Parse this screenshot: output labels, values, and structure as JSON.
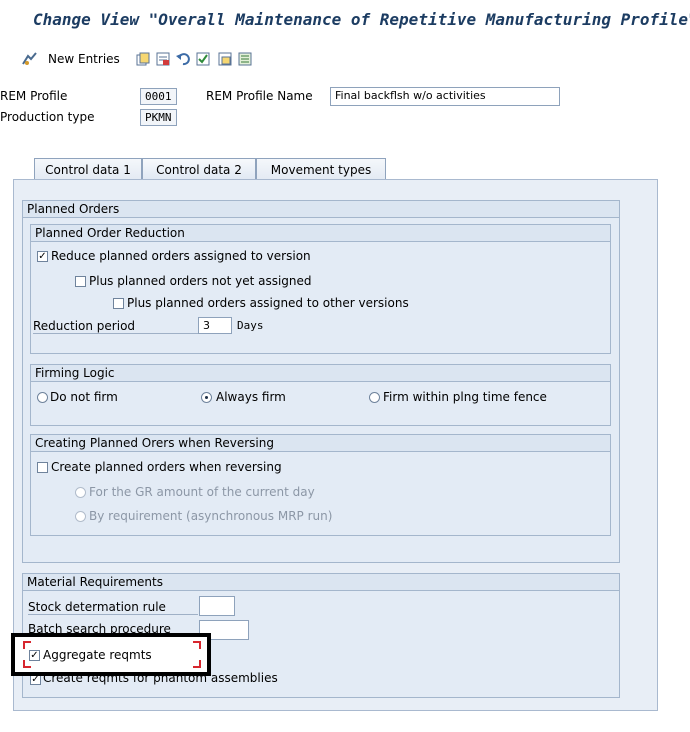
{
  "title": "Change View \"Overall Maintenance of Repetitive Manufacturing Profile\":",
  "toolbar": {
    "new_entries": "New Entries",
    "icons": [
      "change-display-icon",
      "copy-icon",
      "delete-icon",
      "undo-icon",
      "select-all-icon",
      "select-block-icon",
      "deselect-all-icon"
    ]
  },
  "header": {
    "rem_profile_label": "REM Profile",
    "rem_profile_value": "0001",
    "rem_profile_name_label": "REM Profile Name",
    "rem_profile_name_value": "Final backflsh w/o activities",
    "production_type_label": "Production type",
    "production_type_value": "PKMN"
  },
  "tabs": [
    "Control data 1",
    "Control data 2",
    "Movement types"
  ],
  "active_tab": "Control data 2",
  "planned_orders": {
    "title": "Planned Orders",
    "reduction": {
      "title": "Planned Order Reduction",
      "reduce_assigned": "Reduce planned orders assigned to version",
      "plus_not_assigned": "Plus planned orders not yet assigned",
      "plus_other_versions": "Plus planned orders assigned to other versions",
      "reduction_period_label": "Reduction period",
      "reduction_period_value": "3",
      "reduction_period_unit": "Days"
    },
    "firming": {
      "title": "Firming Logic",
      "do_not_firm": "Do not firm",
      "always_firm": "Always firm",
      "firm_within": "Firm within plng time fence"
    },
    "reversing": {
      "title": "Creating Planned Orers when Reversing",
      "create_when_reversing": "Create planned orders when reversing",
      "gr_amount": "For the GR amount of the current day",
      "by_requirement": "By requirement (asynchronous MRP run)"
    }
  },
  "material_requirements": {
    "title": "Material Requirements",
    "stock_rule_label": "Stock determation rule",
    "batch_search_label": "Batch search procedure",
    "aggregate_reqmts": "Aggregate reqmts",
    "create_phantom": "Create reqmts for phantom assemblies"
  },
  "colors": {
    "title_text": "#1c3c62",
    "highlight_frame": "#000000",
    "corner_marks": "#d7262e"
  }
}
